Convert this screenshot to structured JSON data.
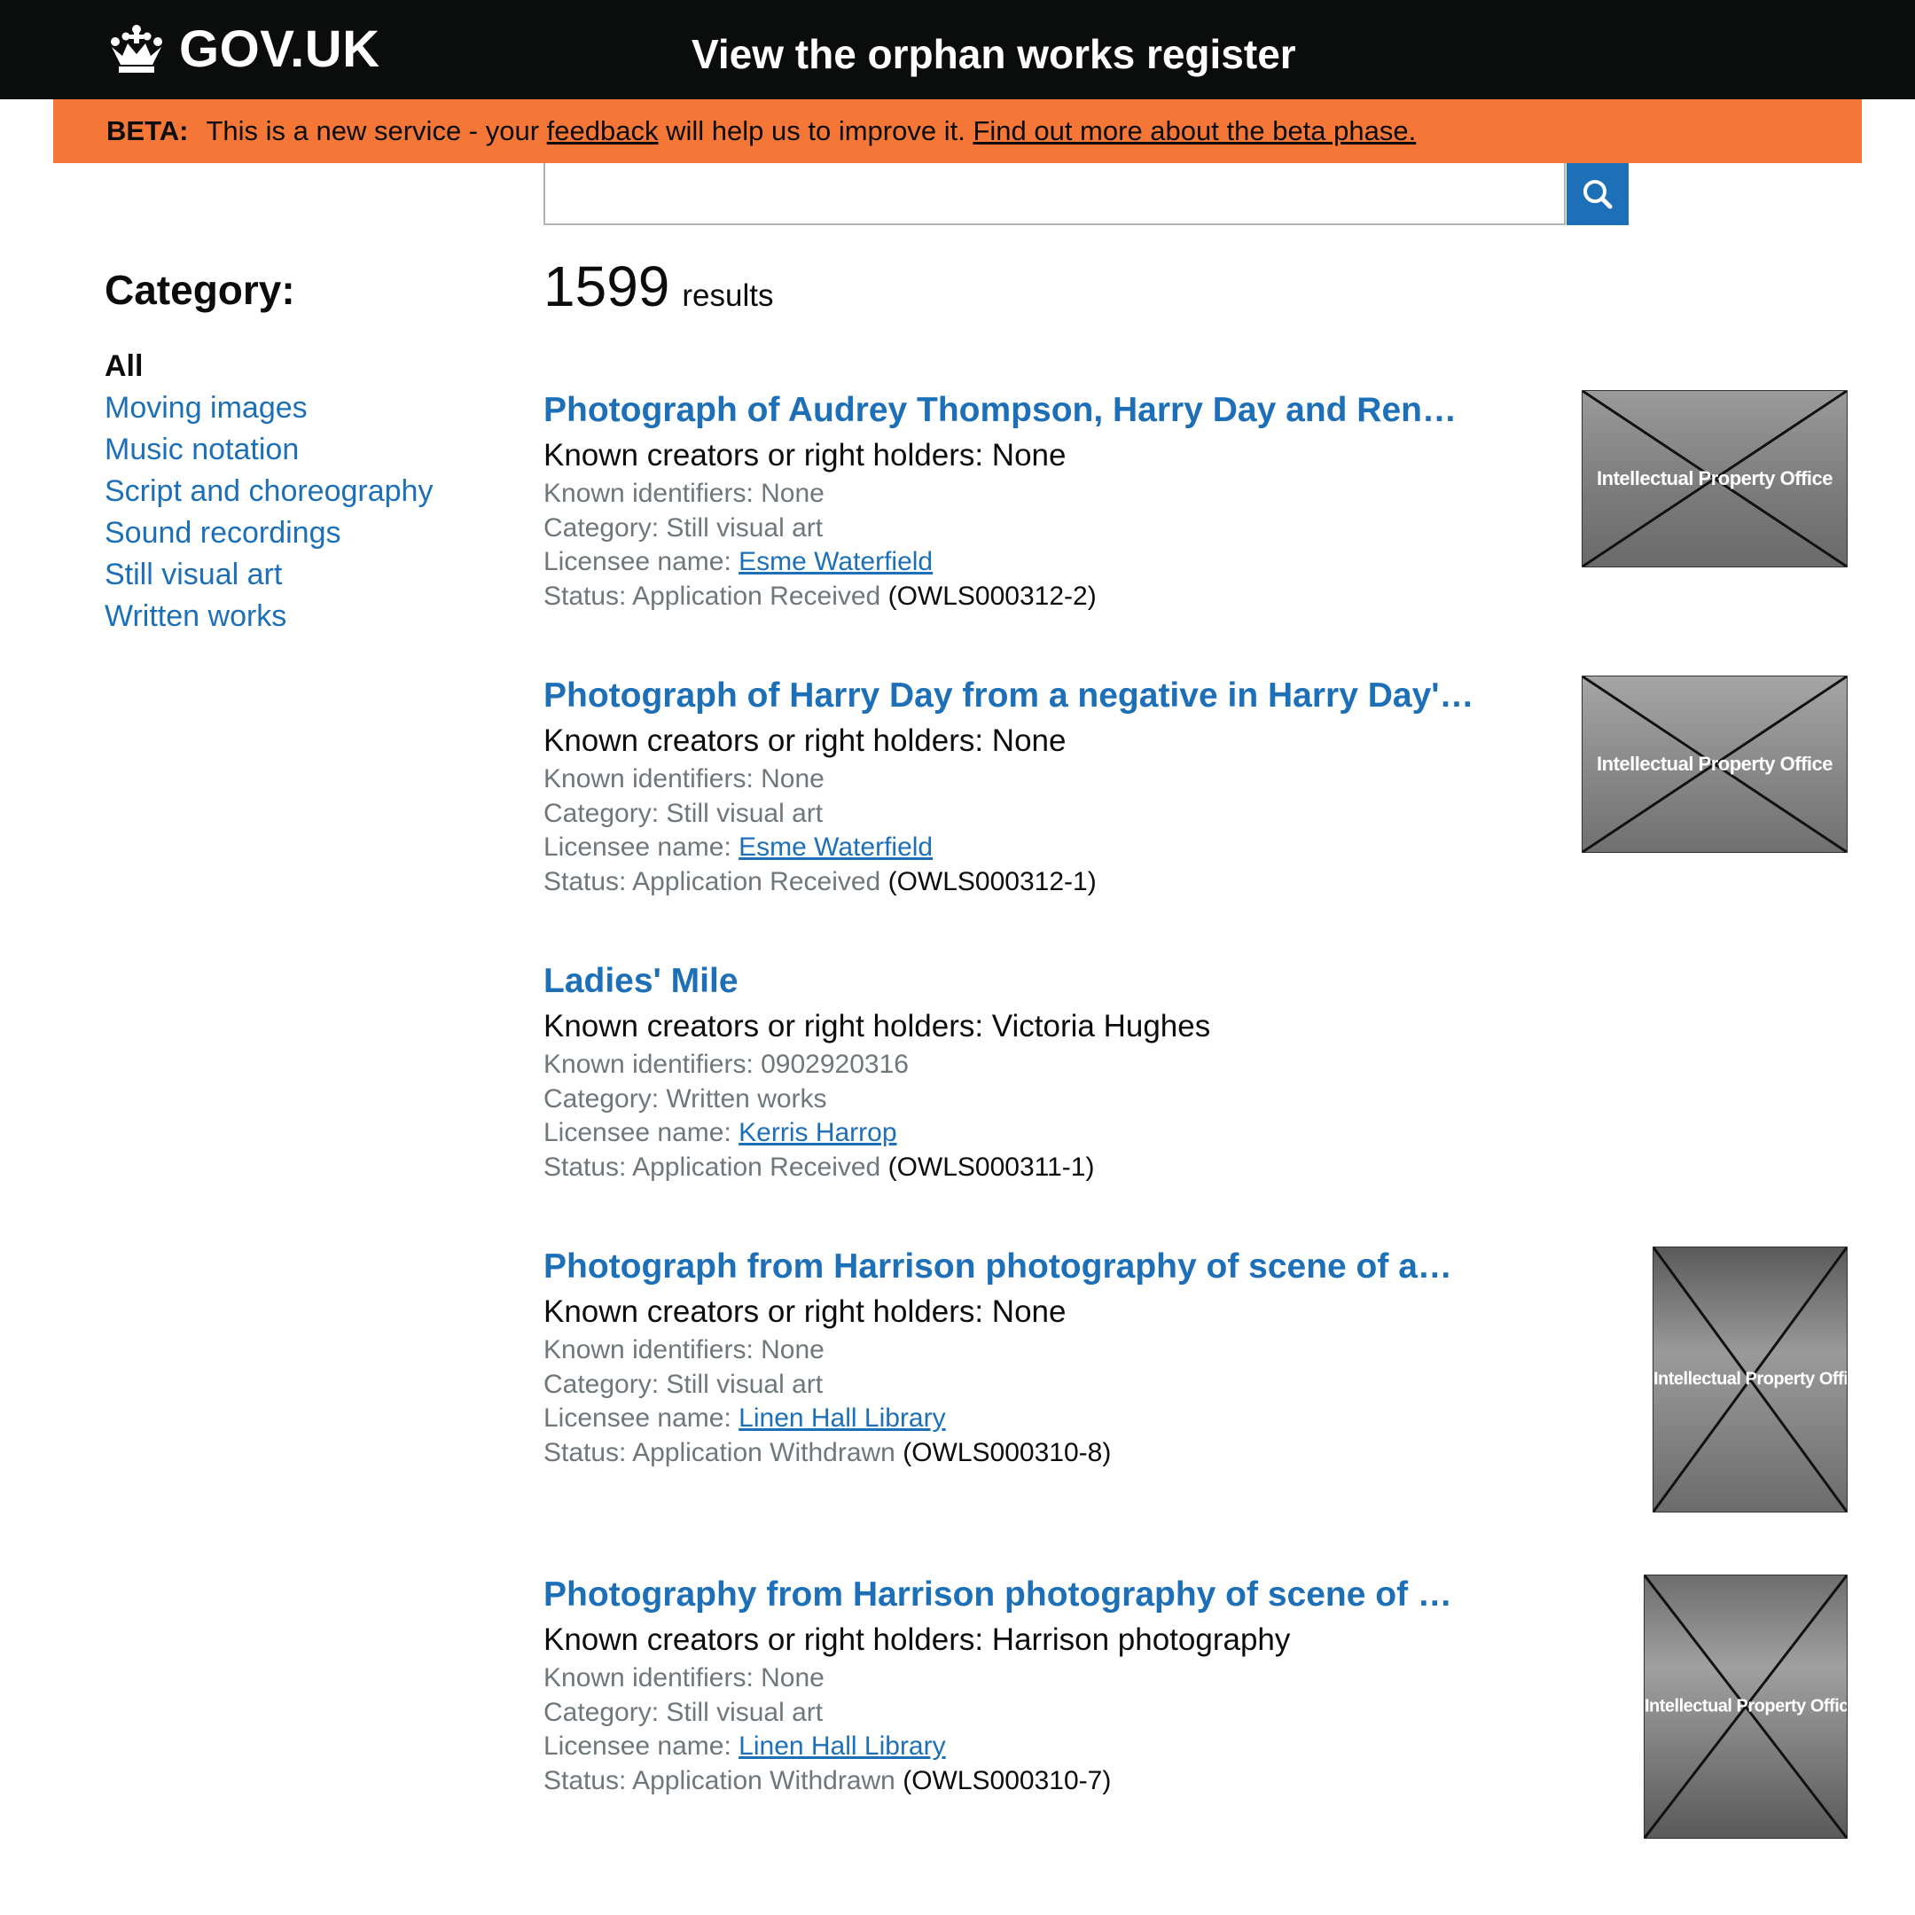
{
  "header": {
    "logo_text": "GOV.UK",
    "service_name": "View the orphan works register"
  },
  "beta": {
    "tag": "BETA:",
    "text_before": "This is a new service - your",
    "feedback_link": "feedback",
    "text_after": "will help us to improve it.",
    "find_out_link": "Find out more about the beta phase."
  },
  "search": {
    "value": "",
    "button_icon": "search-icon"
  },
  "sidebar": {
    "title": "Category:",
    "items": [
      {
        "label": "All",
        "active": true
      },
      {
        "label": "Moving images"
      },
      {
        "label": "Music notation"
      },
      {
        "label": "Script and choreography"
      },
      {
        "label": "Sound recordings"
      },
      {
        "label": "Still visual art"
      },
      {
        "label": "Written works"
      }
    ]
  },
  "results": {
    "count": "1599",
    "count_label": "results",
    "items": [
      {
        "title": "Photograph of Audrey Thompson, Harry Day and Rene Day",
        "creators": "Known creators or right holders: None",
        "identifiers": "Known identifiers: None",
        "category": "Category: Still visual art",
        "licensee_label": "Licensee name:",
        "licensee": "Esme Waterfield",
        "status": "Status: Application Received",
        "ref": "(OWLS000312-2)",
        "thumb_text": "Intellectual Property Office"
      },
      {
        "title": "Photograph of Harry Day from a negative in Harry Day's collection",
        "creators": "Known creators or right holders: None",
        "identifiers": "Known identifiers: None",
        "category": "Category: Still visual art",
        "licensee_label": "Licensee name:",
        "licensee": "Esme Waterfield",
        "status": "Status: Application Received",
        "ref": "(OWLS000312-1)",
        "thumb_text": "Intellectual Property Office"
      },
      {
        "title": "Ladies' Mile",
        "creators": "Known creators or right holders: Victoria Hughes",
        "identifiers": "Known identifiers: 0902920316",
        "category": "Category: Written works",
        "licensee_label": "Licensee name:",
        "licensee": "Kerris Harrop",
        "status": "Status: Application Received",
        "ref": "(OWLS000311-1)"
      },
      {
        "title": "Photograph from Harrison photography of scene of an explosion",
        "creators": "Known creators or right holders: None",
        "identifiers": "Known identifiers: None",
        "category": "Category: Still visual art",
        "licensee_label": "Licensee name:",
        "licensee": "Linen Hall Library",
        "status": "Status: Application Withdrawn",
        "ref": "(OWLS000310-8)",
        "thumb_text": "Intellectual Property Office"
      },
      {
        "title": "Photography from Harrison photography of scene of an explosion",
        "creators": "Known creators or right holders: Harrison photography",
        "identifiers": "Known identifiers: None",
        "category": "Category: Still visual art",
        "licensee_label": "Licensee name:",
        "licensee": "Linen Hall Library",
        "status": "Status: Application Withdrawn",
        "ref": "(OWLS000310-7)",
        "thumb_text": "Intellectual Property Office"
      }
    ]
  },
  "colors": {
    "header_bg": "#0b0c0c",
    "beta_bg": "#f47738",
    "link": "#1d70b8",
    "secondary_text": "#6f777b"
  }
}
